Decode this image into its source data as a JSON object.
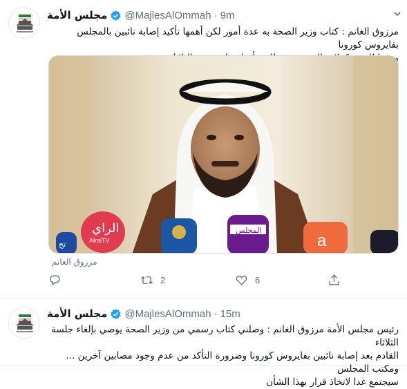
{
  "tweets": [
    {
      "display_name": "مجلس الأمة",
      "handle": "@MajlesAlOmmah",
      "separator": "·",
      "time": "9m",
      "text_line1": "مرزوق الغانم : كتاب وزير الصحة به عدة أمور لكن أهمها تأكيد إصابة نائبين بالمجلس بفايروس كورونا",
      "text_line2": "ووفقا للبروتوكولات الصحية تم طلب تأجيل جلسة يوم الثلاثاء",
      "media_caption": "مرزوق الغانم",
      "retweets": "2",
      "likes": "6",
      "mic_labels": [
        "الراي",
        "AlraiTV",
        "المجلس",
        "a"
      ]
    },
    {
      "display_name": "مجلس الأمة",
      "handle": "@MajlesAlOmmah",
      "separator": "·",
      "time": "15m",
      "text_line1": "رئيس مجلس الأمة مرزوق الغانم : وصلني كتاب رسمي من وزير الصحة يوصي بإلغاء جلسة الثلاثاء",
      "text_line2": "القادم بعد إصابة نائبين بفايروس كورونا وضرورة التأكد من عدم وجود مصابين آخرين ... ومكتب المجلس",
      "text_line3": "سيجتمع غدا لاتخاذ قرار بهذا الشأن"
    }
  ],
  "colors": {
    "verified": "#1da1f2",
    "secondary_text": "#5b7083",
    "divider": "#e6ecf0"
  },
  "icons": [
    "chevron-down-icon",
    "verified-badge-icon",
    "reply-icon",
    "retweet-icon",
    "like-icon",
    "share-icon"
  ]
}
